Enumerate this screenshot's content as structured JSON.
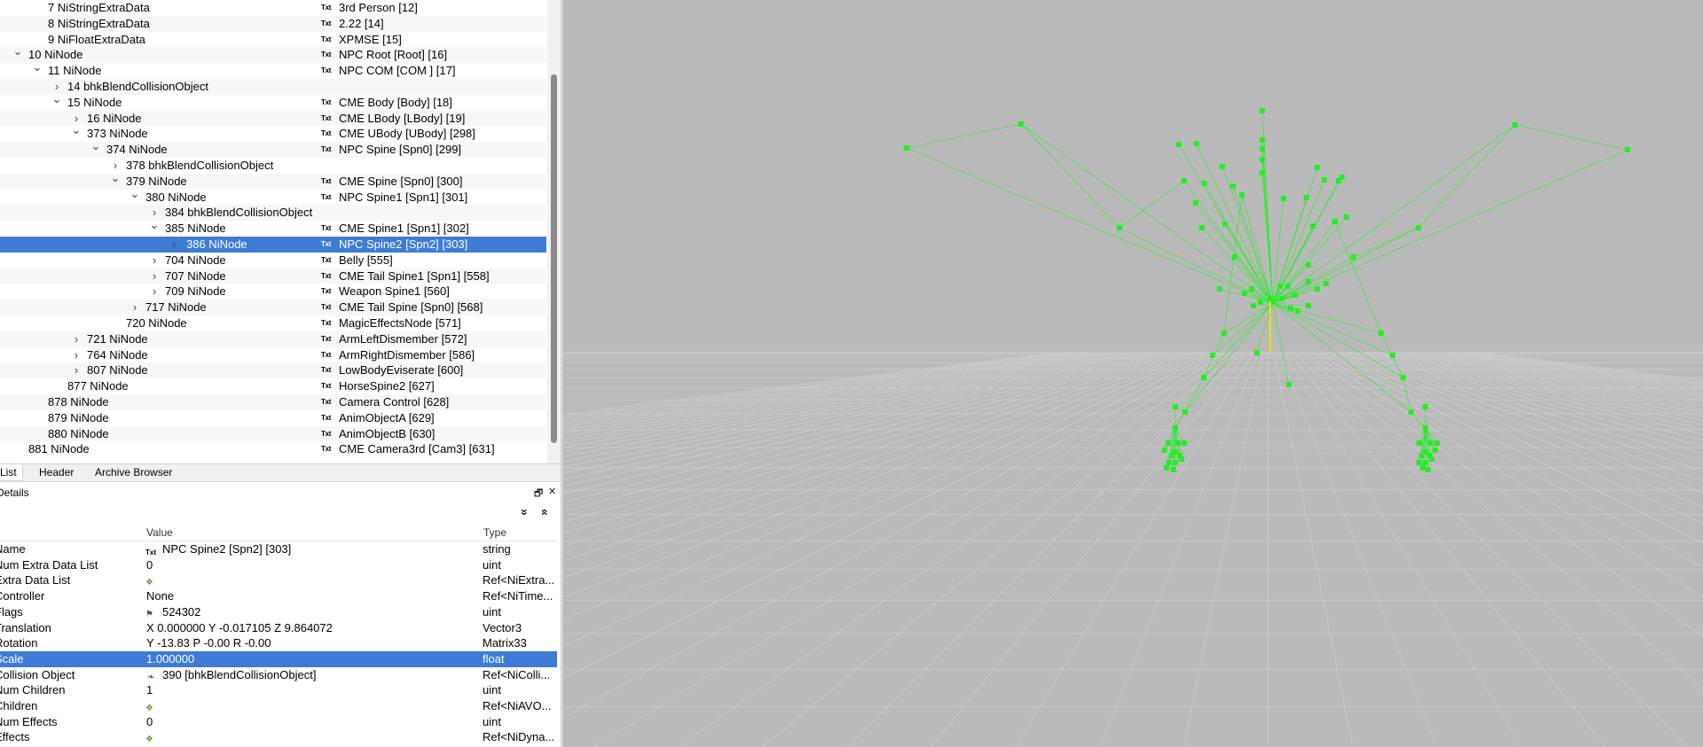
{
  "tree": {
    "rows": [
      {
        "node": "7 NiStringExtraData",
        "value": "3rd Person [12]",
        "expand": ""
      },
      {
        "node": "8 NiStringExtraData",
        "value": "2.22 [14]",
        "expand": ""
      },
      {
        "node": "9 NiFloatExtraData",
        "value": "XPMSE [15]",
        "expand": ""
      },
      {
        "node": "10 NiNode",
        "value": "NPC Root [Root] [16]",
        "expand": "open"
      },
      {
        "node": "11 NiNode",
        "value": "NPC COM [COM ] [17]",
        "expand": "open"
      },
      {
        "node": "14 bhkBlendCollisionObject",
        "value": "",
        "expand": "closed"
      },
      {
        "node": "15 NiNode",
        "value": "CME Body [Body] [18]",
        "expand": "open"
      },
      {
        "node": "16 NiNode",
        "value": "CME LBody [LBody] [19]",
        "expand": "closed"
      },
      {
        "node": "373 NiNode",
        "value": "CME UBody [UBody] [298]",
        "expand": "open"
      },
      {
        "node": "374 NiNode",
        "value": "NPC Spine [Spn0] [299]",
        "expand": "open"
      },
      {
        "node": "378 bhkBlendCollisionObject",
        "value": "",
        "expand": "closed"
      },
      {
        "node": "379 NiNode",
        "value": "CME Spine [Spn0] [300]",
        "expand": "open"
      },
      {
        "node": "380 NiNode",
        "value": "NPC Spine1 [Spn1] [301]",
        "expand": "open"
      },
      {
        "node": "384 bhkBlendCollisionObject",
        "value": "",
        "expand": "closed"
      },
      {
        "node": "385 NiNode",
        "value": "CME Spine1 [Spn1] [302]",
        "expand": "open"
      },
      {
        "node": "386 NiNode",
        "value": "NPC Spine2 [Spn2] [303]",
        "expand": "closed"
      },
      {
        "node": "704 NiNode",
        "value": "Belly [555]",
        "expand": "closed"
      },
      {
        "node": "707 NiNode",
        "value": "CME Tail Spine1 [Spn1] [558]",
        "expand": "closed"
      },
      {
        "node": "709 NiNode",
        "value": "Weapon Spine1 [560]",
        "expand": "closed"
      },
      {
        "node": "717 NiNode",
        "value": "CME Tail Spine [Spn0] [568]",
        "expand": "closed"
      },
      {
        "node": "720 NiNode",
        "value": "MagicEffectsNode [571]",
        "expand": ""
      },
      {
        "node": "721 NiNode",
        "value": "ArmLeftDismember [572]",
        "expand": "closed"
      },
      {
        "node": "764 NiNode",
        "value": "ArmRightDismember [586]",
        "expand": "closed"
      },
      {
        "node": "807 NiNode",
        "value": "LowBodyEviserate [600]",
        "expand": "closed"
      },
      {
        "node": "877 NiNode",
        "value": "HorseSpine2 [627]",
        "expand": ""
      },
      {
        "node": "878 NiNode",
        "value": "Camera Control [628]",
        "expand": ""
      },
      {
        "node": "879 NiNode",
        "value": "AnimObjectA [629]",
        "expand": ""
      },
      {
        "node": "880 NiNode",
        "value": "AnimObjectB [630]",
        "expand": ""
      },
      {
        "node": "881 NiNode",
        "value": "CME Camera3rd [Cam3] [631]",
        "expand": ""
      }
    ],
    "txt_icon": "Txt"
  },
  "tabs": [
    {
      "label": "List",
      "active": true
    },
    {
      "label": "Header",
      "active": false
    },
    {
      "label": "Archive Browser",
      "active": false
    }
  ],
  "details": {
    "title": "Details",
    "restore_icon": "restore-icon",
    "close_glyph": "✕",
    "collapse_all": "»",
    "expand_all": "«",
    "columns": {
      "name": "",
      "value": "Value",
      "type": "Type"
    },
    "rows": [
      {
        "name": "Name",
        "value": "NPC Spine2 [Spn2] [303]",
        "type": "string",
        "icon": "txt"
      },
      {
        "name": "Num Extra Data List",
        "value": "0",
        "type": "uint",
        "icon": ""
      },
      {
        "name": "Extra Data List",
        "value": "",
        "type": "Ref<NiExtra...",
        "icon": "grid"
      },
      {
        "name": "Controller",
        "value": "None",
        "type": "Ref<NiTime...",
        "icon": ""
      },
      {
        "name": "Flags",
        "value": "524302",
        "type": "uint",
        "icon": "flag"
      },
      {
        "name": "Translation",
        "value": "X 0.000000 Y -0.017105 Z 9.864072",
        "type": "Vector3",
        "icon": ""
      },
      {
        "name": "Rotation",
        "value": "Y -13.83 P -0.00 R -0.00",
        "type": "Matrix33",
        "icon": ""
      },
      {
        "name": "Scale",
        "value": "1.000000",
        "type": "float",
        "icon": ""
      },
      {
        "name": "Collision Object",
        "value": "390 [bhkBlendCollisionObject]",
        "type": "Ref<NiColli...",
        "icon": "collision"
      },
      {
        "name": "Num Children",
        "value": "1",
        "type": "uint",
        "icon": ""
      },
      {
        "name": "Children",
        "value": "",
        "type": "Ref<NiAVO...",
        "icon": "grid"
      },
      {
        "name": "Num Effects",
        "value": "0",
        "type": "uint",
        "icon": ""
      },
      {
        "name": "Effects",
        "value": "",
        "type": "Ref<NiDyna...",
        "icon": "grid"
      }
    ]
  },
  "viewport": {
    "background": "#bababa",
    "bone_color": "#22ee22",
    "selected_bone_color": "#e8e800",
    "grid_color": "#cdcdcd"
  },
  "colors": {
    "selection": "#3d7bd6"
  }
}
